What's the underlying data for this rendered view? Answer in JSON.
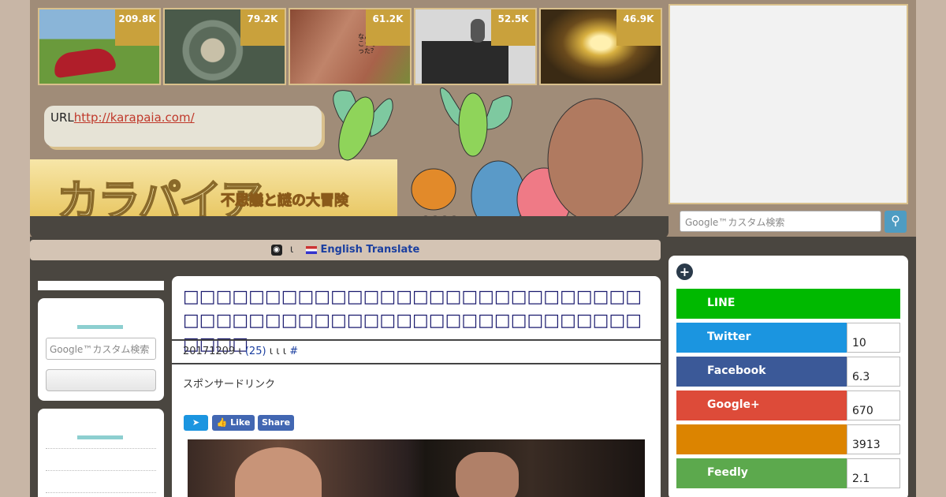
{
  "thumbnails": [
    {
      "count": "209.8K",
      "colors": [
        "#8ab5d8",
        "#6a9a3c",
        "#b01e2a"
      ],
      "icon": "capsule-image"
    },
    {
      "count": "79.2K",
      "colors": [
        "#5a6a5a",
        "#7a8a7a",
        "#c8c0a8"
      ],
      "icon": "highway-image"
    },
    {
      "count": "61.2K",
      "colors": [
        "#a8624a",
        "#c0846a",
        "#7a8a3a"
      ],
      "icon": "cliff-image",
      "overlay_text": "なんでこうなった？"
    },
    {
      "count": "52.5K",
      "colors": [
        "#d8d8d8",
        "#2a2a2a",
        "#888888"
      ],
      "icon": "machine-image"
    },
    {
      "count": "46.9K",
      "colors": [
        "#3a2a14",
        "#d8b040",
        "#fff0b0"
      ],
      "icon": "tunnel-image"
    }
  ],
  "header": {
    "url_label": "URL",
    "url_link": "http://karapaia.com/",
    "logo_text": "カラパイア",
    "tagline": "不思議と謎の大冒険"
  },
  "translate": {
    "separator": "ι",
    "link": "English Translate"
  },
  "search": {
    "placeholder": "Google™カスタム検索",
    "icon": "search-icon"
  },
  "left_sidebar": {
    "search_placeholder": "Google™カスタム検索"
  },
  "article": {
    "title": "□□□□□□□□□□□□□□□□□□□□□□□□□□□□□□□□□□□□□□□□□□□□□□□□□□□□□□□□□□□□",
    "date": "20171209",
    "separator": "ι",
    "comment_count": "(25)",
    "tags": "ι ι ι",
    "hash": "#",
    "sponsor": "スポンサードリンク",
    "share_buttons": {
      "like": "Like",
      "share": "Share"
    }
  },
  "share_panel": {
    "rows": [
      {
        "label": "LINE",
        "count": "",
        "color": "#00b900"
      },
      {
        "label": "Twitter",
        "count": "10",
        "color": "#1b95e0"
      },
      {
        "label": "Facebook",
        "count": "6.3",
        "color": "#3b5998"
      },
      {
        "label": "Google+",
        "count": "670",
        "color": "#dd4b39"
      },
      {
        "label": "",
        "count": "3913",
        "color": "#dc8400"
      },
      {
        "label": "Feedly",
        "count": "2.1",
        "color": "#5ca94d"
      }
    ]
  }
}
